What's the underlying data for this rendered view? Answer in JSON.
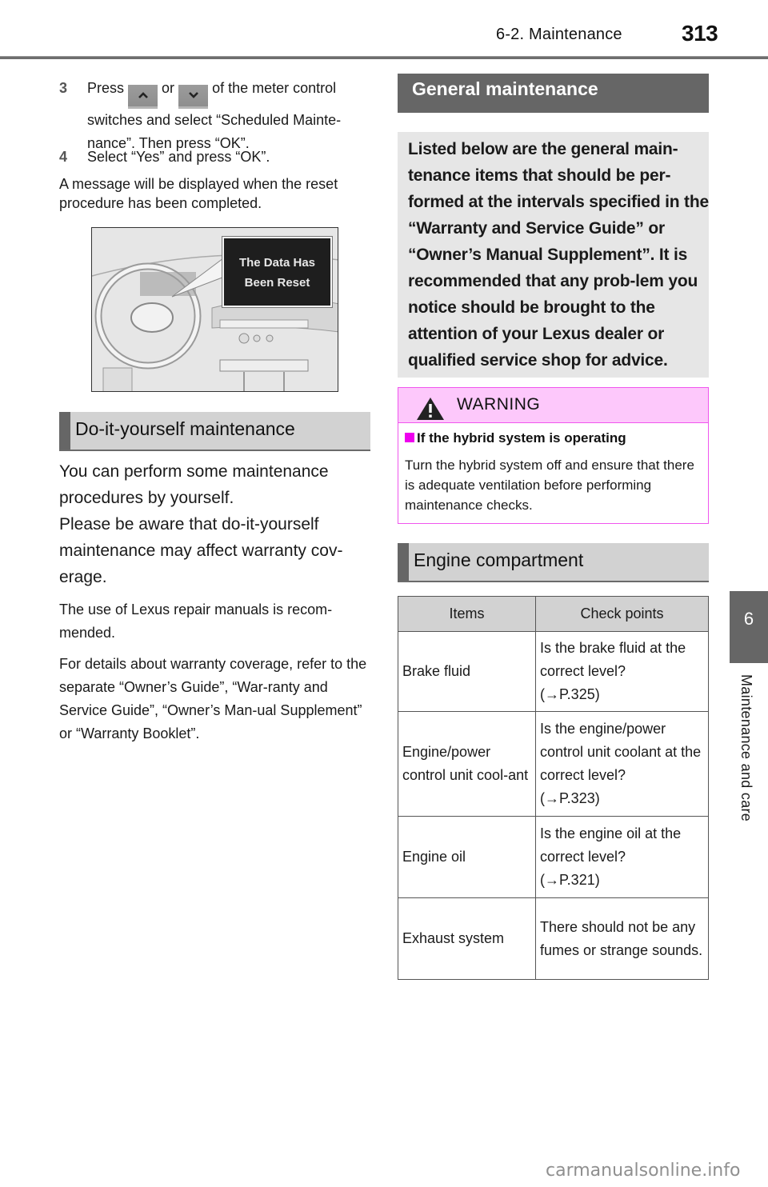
{
  "header": {
    "section": "6-2. Maintenance",
    "page_number": "313"
  },
  "steps": [
    {
      "number": "3",
      "text_before": "Press",
      "button_up_icon": "chevron-up-icon",
      "button_up_glyph": "^",
      "text_or": "or",
      "button_down_icon": "chevron-down-icon",
      "button_down_glyph": "v",
      "text_after": "of the meter control switches and select “Scheduled Mainte-nance”. Then press “OK”."
    },
    {
      "number": "4",
      "text": "Select “Yes” and press “OK”."
    }
  ],
  "reset_note": "A message will be displayed when the reset procedure has been completed.",
  "figure": {
    "callout_line1": "The Data Has",
    "callout_line2": "Been Reset"
  },
  "diy": {
    "heading": "Do-it-yourself maintenance",
    "intro": "You can perform some maintenance procedures by yourself.",
    "intro2": "Please be aware that do-it-yourself maintenance may affect warranty cov-erage.",
    "para1": "The use of Lexus repair manuals is recom-mended.",
    "para2": "For details about warranty coverage, refer to the separate “Owner’s Guide”, “War-ranty and Service Guide”, “Owner’s Man-ual Supplement” or “Warranty Booklet”."
  },
  "general": {
    "heading": "General maintenance",
    "body": "Listed below are the general main-tenance items that should be per-formed at the intervals specified in the “Warranty and Service Guide” or “Owner’s Manual Supplement”. It is recommended that any prob-lem you notice should be brought to the attention of your Lexus dealer or qualified service shop for advice."
  },
  "warning": {
    "title": "WARNING",
    "icon": "warning-triangle-icon",
    "subheading": "If the hybrid system is operating",
    "body": "Turn the hybrid system off and ensure that there is adequate ventilation before performing maintenance checks.",
    "accent_color": "#ee00ee",
    "header_bg": "#fdc8fb"
  },
  "engine": {
    "heading": "Engine compartment",
    "columns": [
      "Items",
      "Check points"
    ],
    "rows": [
      {
        "item": "Brake fluid",
        "check": "Is the brake fluid at the correct level?",
        "ref": "(→P.325)"
      },
      {
        "item": "Engine/power control unit cool-ant",
        "check": "Is the engine/power control unit coolant at the correct level?",
        "ref": "(→P.323)"
      },
      {
        "item": "Engine oil",
        "check": "Is the engine oil at the correct level?",
        "ref": "(→P.321)"
      },
      {
        "item": "Exhaust system",
        "check": "There should not be any fumes or strange sounds.",
        "ref": ""
      }
    ]
  },
  "side_tab": {
    "number": "6",
    "label": "Maintenance and care"
  },
  "watermark": "carmanualsonline.info"
}
